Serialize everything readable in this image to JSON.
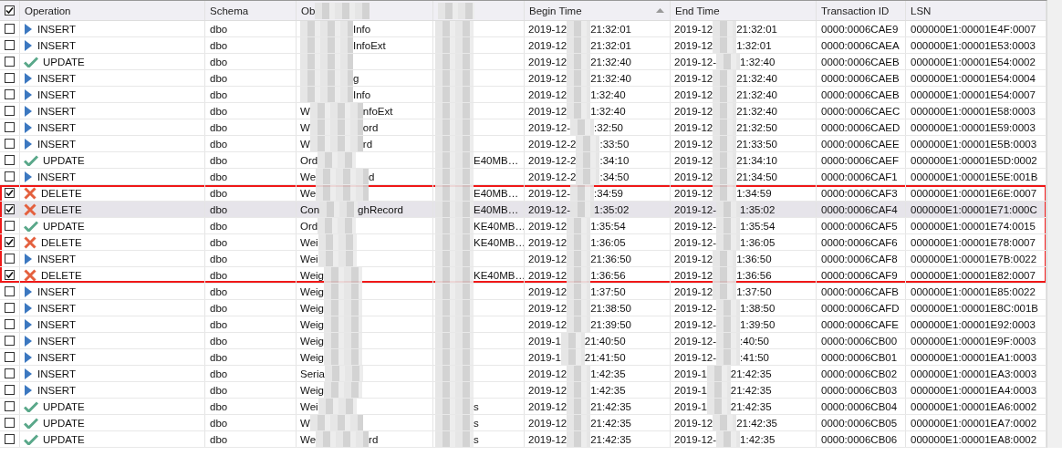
{
  "table": {
    "header_checked": true,
    "columns": [
      {
        "kind": "operation",
        "label": "Operation"
      },
      {
        "kind": "schema",
        "label": "Schema"
      },
      {
        "kind": "object",
        "label": "Ob"
      },
      {
        "kind": "column_5"
      },
      {
        "kind": "begin",
        "label": "Begin Time",
        "sorted": true
      },
      {
        "kind": "end",
        "label": "End Time"
      },
      {
        "kind": "tx",
        "label": "Transaction ID"
      },
      {
        "kind": "lsn",
        "label": "LSN"
      }
    ],
    "rows": [
      {
        "checked": false,
        "selected": false,
        "framed": false,
        "kind": "insert",
        "operation": "INSERT",
        "schema": "dbo",
        "object": {
          "end": "Info"
        },
        "begin": {
          "start": "2019-12",
          "end": "21:32:01"
        },
        "end": {
          "start": "2019-12",
          "end": "21:32:01"
        },
        "tx": "0000:0006CAE9",
        "lsn": "000000E1:00001E4F:0007"
      },
      {
        "checked": false,
        "selected": false,
        "framed": false,
        "kind": "insert",
        "operation": "INSERT",
        "schema": "dbo",
        "object": {
          "end": "InfoExt"
        },
        "begin": {
          "start": "2019-12",
          "end": "21:32:01"
        },
        "end": {
          "start": "2019-12",
          "end": "1:32:01"
        },
        "tx": "0000:0006CAEA",
        "lsn": "000000E1:00001E53:0003"
      },
      {
        "checked": false,
        "selected": false,
        "framed": false,
        "kind": "update",
        "operation": "UPDATE",
        "schema": "dbo",
        "begin": {
          "start": "2019-12",
          "end": "21:32:40"
        },
        "end": {
          "start": "2019-12-",
          "end": "1:32:40"
        },
        "tx": "0000:0006CAEB",
        "lsn": "000000E1:00001E54:0002"
      },
      {
        "checked": false,
        "selected": false,
        "framed": false,
        "kind": "insert",
        "operation": "INSERT",
        "schema": "dbo",
        "object": {
          "end": "g"
        },
        "begin": {
          "start": "2019-12",
          "end": "21:32:40"
        },
        "end": {
          "start": "2019-12",
          "end": "21:32:40"
        },
        "tx": "0000:0006CAEB",
        "lsn": "000000E1:00001E54:0004"
      },
      {
        "checked": false,
        "selected": false,
        "framed": false,
        "kind": "insert",
        "operation": "INSERT",
        "schema": "dbo",
        "object": {
          "end": "Info"
        },
        "begin": {
          "start": "2019-12",
          "end": "1:32:40"
        },
        "end": {
          "start": "2019-12",
          "end": "21:32:40"
        },
        "tx": "0000:0006CAEB",
        "lsn": "000000E1:00001E54:0007"
      },
      {
        "checked": false,
        "selected": false,
        "framed": false,
        "kind": "insert",
        "operation": "INSERT",
        "schema": "dbo",
        "object": {
          "start": "W",
          "end": "nfoExt"
        },
        "begin": {
          "start": "2019-12",
          "end": "1:32:40"
        },
        "end": {
          "start": "2019-12",
          "end": "21:32:40"
        },
        "tx": "0000:0006CAEC",
        "lsn": "000000E1:00001E58:0003"
      },
      {
        "checked": false,
        "selected": false,
        "framed": false,
        "kind": "insert",
        "operation": "INSERT",
        "schema": "dbo",
        "object": {
          "start": "W",
          "end": "ord"
        },
        "begin": {
          "start": "2019-12-",
          "end": ":32:50"
        },
        "end": {
          "start": "2019-12",
          "end": "21:32:50"
        },
        "tx": "0000:0006CAED",
        "lsn": "000000E1:00001E59:0003"
      },
      {
        "checked": false,
        "selected": false,
        "framed": false,
        "kind": "insert",
        "operation": "INSERT",
        "schema": "dbo",
        "object": {
          "start": "W",
          "end": "rd"
        },
        "begin": {
          "start": "2019-12-2",
          "end": ":33:50"
        },
        "end": {
          "start": "2019-12",
          "end": "21:33:50"
        },
        "tx": "0000:0006CAEE",
        "lsn": "000000E1:00001E5B:0003"
      },
      {
        "checked": false,
        "selected": false,
        "framed": false,
        "kind": "update",
        "operation": "UPDATE",
        "schema": "dbo",
        "object": {
          "start": "Ord"
        },
        "column_5": "E40MB…",
        "begin": {
          "start": "2019-12-2",
          "end": ":34:10"
        },
        "end": {
          "start": "2019-12",
          "end": "21:34:10"
        },
        "tx": "0000:0006CAEF",
        "lsn": "000000E1:00001E5D:0002"
      },
      {
        "checked": false,
        "selected": false,
        "framed": false,
        "kind": "insert",
        "operation": "INSERT",
        "schema": "dbo",
        "object": {
          "start": "We",
          "end": "d"
        },
        "begin": {
          "start": "2019-12-2",
          "end": ":34:50"
        },
        "end": {
          "start": "2019-12",
          "end": "21:34:50"
        },
        "tx": "0000:0006CAF1",
        "lsn": "000000E1:00001E5E:001B"
      },
      {
        "checked": true,
        "selected": false,
        "framed": true,
        "kind": "delete",
        "operation": "DELETE",
        "schema": "dbo",
        "object": {
          "start": "We"
        },
        "column_5": "E40MB…",
        "begin": {
          "start": "2019-12-",
          "end": ":34:59"
        },
        "end": {
          "start": "2019-12",
          "end": "1:34:59"
        },
        "tx": "0000:0006CAF3",
        "lsn": "000000E1:00001E6E:0007"
      },
      {
        "checked": true,
        "selected": true,
        "framed": true,
        "kind": "delete",
        "operation": "DELETE",
        "schema": "dbo",
        "object": {
          "start": "Con",
          "end": "ghRecord"
        },
        "column_5": "E40MB…",
        "begin": {
          "start": "2019-12-",
          "end": "1:35:02"
        },
        "end": {
          "start": "2019-12-",
          "end": "1:35:02"
        },
        "tx": "0000:0006CAF4",
        "lsn": "000000E1:00001E71:000C"
      },
      {
        "checked": false,
        "selected": false,
        "framed": true,
        "kind": "update",
        "operation": "UPDATE",
        "schema": "dbo",
        "object": {
          "start": "Ord"
        },
        "column_5": "KE40MB…",
        "begin": {
          "start": "2019-12",
          "end": "1:35:54"
        },
        "end": {
          "start": "2019-12-",
          "end": "1:35:54"
        },
        "tx": "0000:0006CAF5",
        "lsn": "000000E1:00001E74:0015"
      },
      {
        "checked": true,
        "selected": false,
        "framed": true,
        "kind": "delete",
        "operation": "DELETE",
        "schema": "dbo",
        "object": {
          "start": "Wei"
        },
        "column_5": "KE40MB…",
        "begin": {
          "start": "2019-12",
          "end": "1:36:05"
        },
        "end": {
          "start": "2019-12-",
          "end": "1:36:05"
        },
        "tx": "0000:0006CAF6",
        "lsn": "000000E1:00001E78:0007"
      },
      {
        "checked": false,
        "selected": false,
        "framed": true,
        "kind": "insert",
        "operation": "INSERT",
        "schema": "dbo",
        "object": {
          "start": "Wei"
        },
        "begin": {
          "start": "2019-12",
          "end": "21:36:50"
        },
        "end": {
          "start": "2019-12",
          "end": "1:36:50"
        },
        "tx": "0000:0006CAF8",
        "lsn": "000000E1:00001E7B:0022"
      },
      {
        "checked": true,
        "selected": false,
        "framed": true,
        "kind": "delete",
        "operation": "DELETE",
        "schema": "dbo",
        "object": {
          "start": "Weig"
        },
        "column_5": "KE40MB…",
        "begin": {
          "start": "2019-12",
          "end": "1:36:56"
        },
        "end": {
          "start": "2019-12",
          "end": "1:36:56"
        },
        "tx": "0000:0006CAF9",
        "lsn": "000000E1:00001E82:0007"
      },
      {
        "checked": false,
        "selected": false,
        "framed": false,
        "kind": "insert",
        "operation": "INSERT",
        "schema": "dbo",
        "object": {
          "start": "Weig"
        },
        "begin": {
          "start": "2019-12",
          "end": "1:37:50"
        },
        "end": {
          "start": "2019-12",
          "end": "1:37:50"
        },
        "tx": "0000:0006CAFB",
        "lsn": "000000E1:00001E85:0022"
      },
      {
        "checked": false,
        "selected": false,
        "framed": false,
        "kind": "insert",
        "operation": "INSERT",
        "schema": "dbo",
        "object": {
          "start": "Weig"
        },
        "begin": {
          "start": "2019-12",
          "end": "21:38:50"
        },
        "end": {
          "start": "2019-12-",
          "end": "1:38:50"
        },
        "tx": "0000:0006CAFD",
        "lsn": "000000E1:00001E8C:001B"
      },
      {
        "checked": false,
        "selected": false,
        "framed": false,
        "kind": "insert",
        "operation": "INSERT",
        "schema": "dbo",
        "object": {
          "start": "Weig"
        },
        "begin": {
          "start": "2019-12",
          "end": "21:39:50"
        },
        "end": {
          "start": "2019-12-",
          "end": "1:39:50"
        },
        "tx": "0000:0006CAFE",
        "lsn": "000000E1:00001E92:0003"
      },
      {
        "checked": false,
        "selected": false,
        "framed": false,
        "kind": "insert",
        "operation": "INSERT",
        "schema": "dbo",
        "object": {
          "start": "Weig"
        },
        "begin": {
          "start": "2019-1",
          "end": "21:40:50"
        },
        "end": {
          "start": "2019-12-",
          "end": ":40:50"
        },
        "tx": "0000:0006CB00",
        "lsn": "000000E1:00001E9F:0003"
      },
      {
        "checked": false,
        "selected": false,
        "framed": false,
        "kind": "insert",
        "operation": "INSERT",
        "schema": "dbo",
        "object": {
          "start": "Weig"
        },
        "begin": {
          "start": "2019-1",
          "end": "21:41:50"
        },
        "end": {
          "start": "2019-12-",
          "end": ":41:50"
        },
        "tx": "0000:0006CB01",
        "lsn": "000000E1:00001EA1:0003"
      },
      {
        "checked": false,
        "selected": false,
        "framed": false,
        "kind": "insert",
        "operation": "INSERT",
        "schema": "dbo",
        "object": {
          "start": "Seria"
        },
        "begin": {
          "start": "2019-12",
          "end": "1:42:35"
        },
        "end": {
          "start": "2019-1",
          "end": "21:42:35"
        },
        "tx": "0000:0006CB02",
        "lsn": "000000E1:00001EA3:0003"
      },
      {
        "checked": false,
        "selected": false,
        "framed": false,
        "kind": "insert",
        "operation": "INSERT",
        "schema": "dbo",
        "object": {
          "start": "Weig"
        },
        "begin": {
          "start": "2019-12",
          "end": "1:42:35"
        },
        "end": {
          "start": "2019-1",
          "end": "21:42:35"
        },
        "tx": "0000:0006CB03",
        "lsn": "000000E1:00001EA4:0003"
      },
      {
        "checked": false,
        "selected": false,
        "framed": false,
        "kind": "update",
        "operation": "UPDATE",
        "schema": "dbo",
        "object": {
          "start": "Wei"
        },
        "column_5": "s",
        "begin": {
          "start": "2019-12",
          "end": "21:42:35"
        },
        "end": {
          "start": "2019-1",
          "end": "21:42:35"
        },
        "tx": "0000:0006CB04",
        "lsn": "000000E1:00001EA6:0002"
      },
      {
        "checked": false,
        "selected": false,
        "framed": false,
        "kind": "update",
        "operation": "UPDATE",
        "schema": "dbo",
        "object": {
          "start": "W"
        },
        "column_5": "s",
        "begin": {
          "start": "2019-12",
          "end": "21:42:35"
        },
        "end": {
          "start": "2019-12",
          "end": "21:42:35"
        },
        "tx": "0000:0006CB05",
        "lsn": "000000E1:00001EA7:0002"
      },
      {
        "checked": false,
        "selected": false,
        "framed": false,
        "kind": "update",
        "operation": "UPDATE",
        "schema": "dbo",
        "object": {
          "start": "We",
          "end": "rd"
        },
        "column_5": "s",
        "begin": {
          "start": "2019-12",
          "end": "21:42:35"
        },
        "end": {
          "start": "2019-12-",
          "end": "1:42:35"
        },
        "tx": "0000:0006CB06",
        "lsn": "000000E1:00001EA8:0002"
      }
    ]
  }
}
